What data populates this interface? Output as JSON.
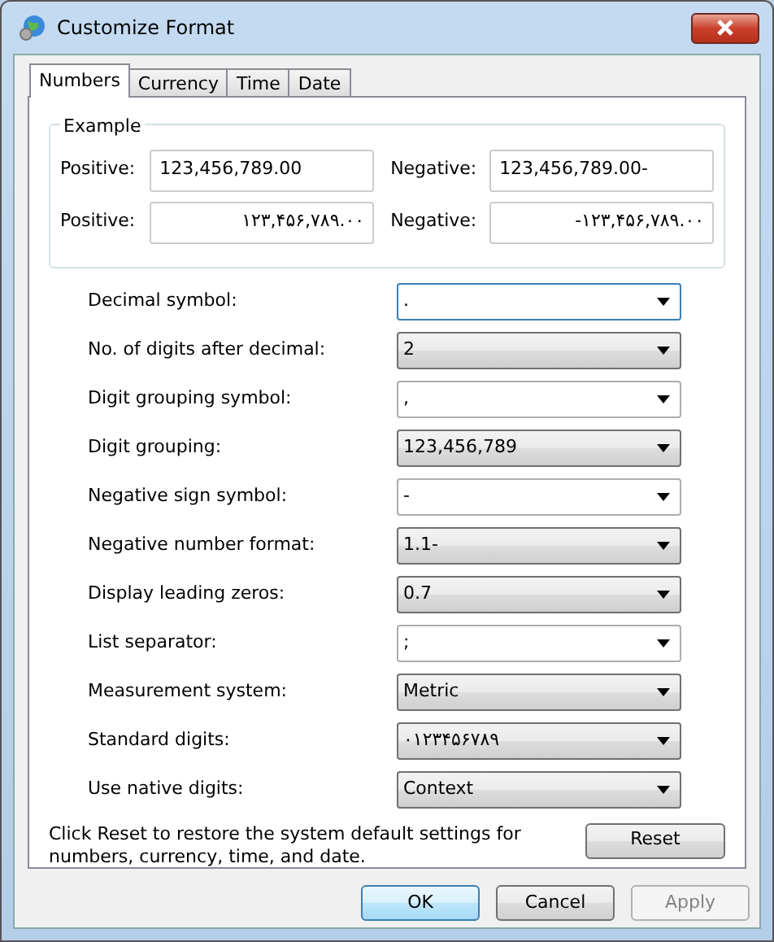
{
  "window": {
    "title": "Customize Format"
  },
  "tabs": [
    {
      "label": "Numbers",
      "selected": true
    },
    {
      "label": "Currency",
      "selected": false
    },
    {
      "label": "Time",
      "selected": false
    },
    {
      "label": "Date",
      "selected": false
    }
  ],
  "example": {
    "title": "Example",
    "rows": [
      {
        "positive_label": "Positive:",
        "positive": "123,456,789.00",
        "negative_label": "Negative:",
        "negative": "123,456,789.00-",
        "kind": "latin"
      },
      {
        "positive_label": "Positive:",
        "positive": "۱۲۳,۴۵۶,۷۸۹.۰۰",
        "negative_label": "Negative:",
        "negative": "-۱۲۳,۴۵۶,۷۸۹.۰۰",
        "kind": "native"
      }
    ]
  },
  "settings": [
    {
      "label": "Decimal symbol:",
      "value": ".",
      "kind": "editable",
      "focused": true
    },
    {
      "label": "No. of digits after decimal:",
      "value": "2",
      "kind": "list",
      "focused": false
    },
    {
      "label": "Digit grouping symbol:",
      "value": ",",
      "kind": "editable",
      "focused": false
    },
    {
      "label": "Digit grouping:",
      "value": "123,456,789",
      "kind": "list",
      "focused": false
    },
    {
      "label": "Negative sign symbol:",
      "value": "-",
      "kind": "editable",
      "focused": false
    },
    {
      "label": "Negative number format:",
      "value": "1.1-",
      "kind": "list",
      "focused": false
    },
    {
      "label": "Display leading zeros:",
      "value": "0.7",
      "kind": "list",
      "focused": false
    },
    {
      "label": "List separator:",
      "value": ";",
      "kind": "editable",
      "focused": false
    },
    {
      "label": "Measurement system:",
      "value": "Metric",
      "kind": "list",
      "focused": false
    },
    {
      "label": "Standard digits:",
      "value": "۰۱۲۳۴۵۶۷۸۹",
      "kind": "list",
      "focused": false
    },
    {
      "label": "Use native digits:",
      "value": "Context",
      "kind": "list",
      "focused": false
    }
  ],
  "reset_note": "Click Reset to restore the system default settings for numbers, currency, time, and date.",
  "reset_button": "Reset",
  "buttons": [
    {
      "label": "OK",
      "default": true,
      "disabled": false
    },
    {
      "label": "Cancel",
      "default": false,
      "disabled": false
    },
    {
      "label": "Apply",
      "default": false,
      "disabled": true
    }
  ]
}
